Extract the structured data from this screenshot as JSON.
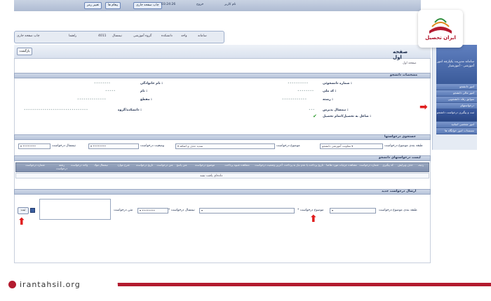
{
  "topbar": {
    "user_label": "نام کاربر",
    "logout_label": "خروج",
    "time_label": "03:24:26",
    "button_a": "تغییر رمز",
    "button_b": "پیغام ها",
    "button_c": "چاپ صفحه جاری"
  },
  "navbar": {
    "items": [
      "سامانه",
      "واحد",
      "دانشکده",
      "گروه آموزشی",
      "نیمسال",
      "4011"
    ],
    "help_label": "راهنما",
    "print_label": "چاپ صفحه جاری"
  },
  "page": {
    "title": "صفحه اول",
    "back_button": "بازگشت",
    "breadcrumb": "صفحه اول"
  },
  "student_info": {
    "section_title": "مشخصات دانشجو",
    "fields": [
      {
        "label": "شماره دانشجوئی :",
        "value": "••••••••••"
      },
      {
        "label": "کد ملی :",
        "value": "••••••••"
      },
      {
        "label": "رشته :",
        "value": "••••••••••••"
      },
      {
        "label": "نیمسال پذیرش :",
        "value": "•••"
      },
      {
        "label": "شاغل به تحصیل/اتمام تحصیل :",
        "value": "✔"
      },
      {
        "label": "نام خانوادگی :",
        "value": "••••••••"
      },
      {
        "label": "نام :",
        "value": "•••••"
      },
      {
        "label": "مقطع :",
        "value": "••••••••••••••"
      },
      {
        "label": "دانشکده/گروه :",
        "value": "•••••••••••••••••••••••••••••••"
      }
    ]
  },
  "search": {
    "section_title": "جستجوی درخواستها",
    "category_label": "طبقه بندی موضوع درخواست",
    "category_value": "معاونت آموزشی دانشجو",
    "subject_label": "موضوع درخواست",
    "subject_value": "تمدید حذف و اضافه",
    "status_label": "وضعیت درخواست",
    "status_value": "••••••••",
    "term_label": "نیمسال درخواست",
    "term_value": "••••••••"
  },
  "requests_table": {
    "section_title": "لیست درخواستهای دانشجو",
    "columns": [
      "ردیف",
      "حذف ویرایش",
      "کد پیگیری",
      "شماره درخواست",
      "مشاهده جزئیات مورد تقاضا",
      "تاریخ پرداخت یا عدم نیاز به پرداخت",
      "آخرین وضعیت درخواست",
      "مشاهده شیوه پرداخت",
      "موضوع درخواست",
      "متن پاسخ",
      "متن درخواست",
      "تاریخ درخواست",
      "شرح موارد",
      "نیمسال مواد",
      "واحد درخواست",
      "رشته درخواست",
      "شماره درخواست"
    ],
    "empty_text": "داده‌ای یافت نشد"
  },
  "new_request": {
    "section_title": "ارسال درخواست جدید",
    "category_label": "طبقه بندی موضوع درخواست",
    "subject_label": "* موضوع درخواست",
    "term_label": "* نیمسال درخواست",
    "term_value": "••••••••",
    "text_label": "متن درخواست",
    "submit_label": "ثبت"
  },
  "sidebar": {
    "title": "سامانه مدیریت یکپارچه امور آموزشی - آموزشیار",
    "items": [
      "امور دانشجو",
      "امور مالی دانشجو",
      "سوابق رفاه دانشجویی",
      "درخواستهای",
      "ثبت و پیگیری درخواست دانشجو",
      "امور شخصی اساتید",
      "مستندات امور خوابگاه ها"
    ]
  },
  "watermark": {
    "brand": "ایران تحصیل",
    "site": "irantahsil.org"
  },
  "colors": {
    "accent": "#3a5a99",
    "brand_red": "#b31b2f",
    "arrow": "#e01e1e"
  }
}
